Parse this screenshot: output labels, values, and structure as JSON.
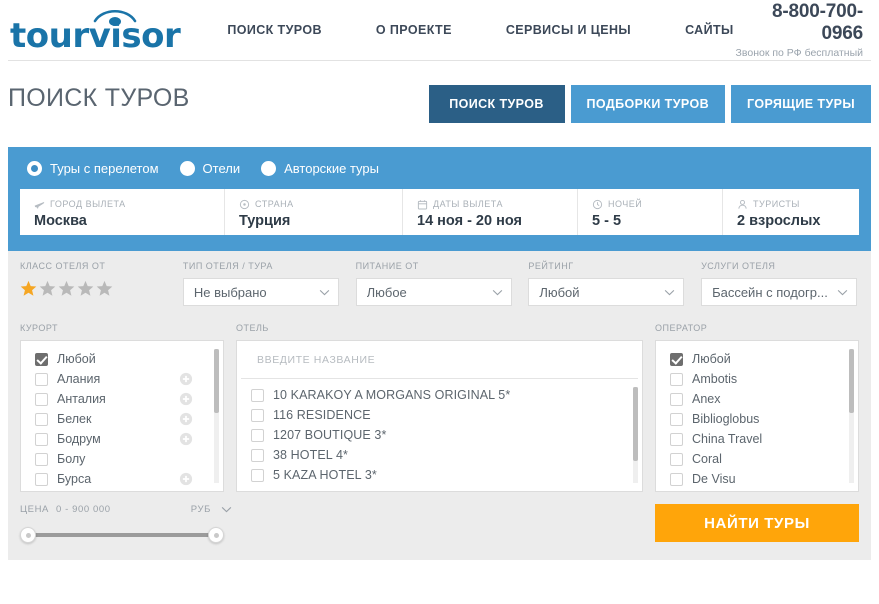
{
  "header": {
    "logo_text": "tourvisor",
    "logo_icon": "eye-logo-icon",
    "nav": [
      {
        "label": "ПОИСК ТУРОВ"
      },
      {
        "label": "О ПРОЕКТЕ"
      },
      {
        "label": "СЕРВИСЫ И ЦЕНЫ"
      },
      {
        "label": "САЙТЫ"
      }
    ],
    "phone": "8-800-700-0966",
    "phone_note": "Звонок по РФ бесплатный"
  },
  "page": {
    "title": "ПОИСК ТУРОВ",
    "tabs": [
      {
        "label": "ПОИСК ТУРОВ",
        "active": true
      },
      {
        "label": "ПОДБОРКИ ТУРОВ",
        "active": false
      },
      {
        "label": "ГОРЯЩИЕ ТУРЫ",
        "active": false
      }
    ]
  },
  "search_panel": {
    "accent_color": "#4a9bd1",
    "radios": [
      {
        "label": "Туры с перелетом",
        "selected": true
      },
      {
        "label": "Отели",
        "selected": false
      },
      {
        "label": "Авторские туры",
        "selected": false
      }
    ],
    "fields": [
      {
        "icon": "plane-icon",
        "label": "ГОРОД ВЫЛЕТА",
        "value": "Москва"
      },
      {
        "icon": "pin-icon",
        "label": "СТРАНА",
        "value": "Турция"
      },
      {
        "icon": "calendar-icon",
        "label": "ДАТЫ ВЫЛЕТА",
        "value": "14 ноя - 20 ноя"
      },
      {
        "icon": "clock-icon",
        "label": "НОЧЕЙ",
        "value": "5 - 5"
      },
      {
        "icon": "person-icon",
        "label": "ТУРИСТЫ",
        "value": "2 взрослых"
      }
    ]
  },
  "filters": {
    "hotel_class": {
      "label": "КЛАСС ОТЕЛЯ ОТ",
      "stars_total": 5,
      "stars_filled": 1,
      "star_on_color": "#f5a623",
      "star_off_color": "#b9b9b9"
    },
    "selects": [
      {
        "label": "ТИП ОТЕЛЯ / ТУРА",
        "value": "Не выбрано"
      },
      {
        "label": "ПИТАНИЕ ОТ",
        "value": "Любое"
      },
      {
        "label": "РЕЙТИНГ",
        "value": "Любой"
      },
      {
        "label": "УСЛУГИ ОТЕЛЯ",
        "value": "Бассейн с подогр..."
      }
    ],
    "resort": {
      "label": "КУРОРТ",
      "items": [
        {
          "name": "Любой",
          "checked": true,
          "plus": false
        },
        {
          "name": "Алания",
          "checked": false,
          "plus": true
        },
        {
          "name": "Анталия",
          "checked": false,
          "plus": true
        },
        {
          "name": "Белек",
          "checked": false,
          "plus": true
        },
        {
          "name": "Бодрум",
          "checked": false,
          "plus": true
        },
        {
          "name": "Болу",
          "checked": false,
          "plus": false
        },
        {
          "name": "Бурса",
          "checked": false,
          "plus": true
        }
      ]
    },
    "hotel": {
      "label": "ОТЕЛЬ",
      "search_placeholder": "ВВЕДИТЕ НАЗВАНИЕ",
      "search_value": "",
      "items": [
        {
          "name": "10 KARAKOY A MORGANS ORIGINAL 5*",
          "checked": false
        },
        {
          "name": "116 RESIDENCE",
          "checked": false
        },
        {
          "name": "1207 BOUTIQUE 3*",
          "checked": false
        },
        {
          "name": "38 HOTEL 4*",
          "checked": false
        },
        {
          "name": "5 KAZA HOTEL 3*",
          "checked": false
        }
      ]
    },
    "operator": {
      "label": "ОПЕРАТОР",
      "items": [
        {
          "name": "Любой",
          "checked": true
        },
        {
          "name": "Ambotis",
          "checked": false
        },
        {
          "name": "Anex",
          "checked": false
        },
        {
          "name": "Biblioglobus",
          "checked": false
        },
        {
          "name": "China Travel",
          "checked": false
        },
        {
          "name": "Coral",
          "checked": false
        },
        {
          "name": "De Visu",
          "checked": false
        }
      ]
    },
    "price": {
      "label": "ЦЕНА",
      "range": "0 - 900 000",
      "currency": "РУБ",
      "min": 0,
      "max": 900000
    },
    "submit_label": "НАЙТИ ТУРЫ",
    "submit_color": "#ffa50a"
  }
}
